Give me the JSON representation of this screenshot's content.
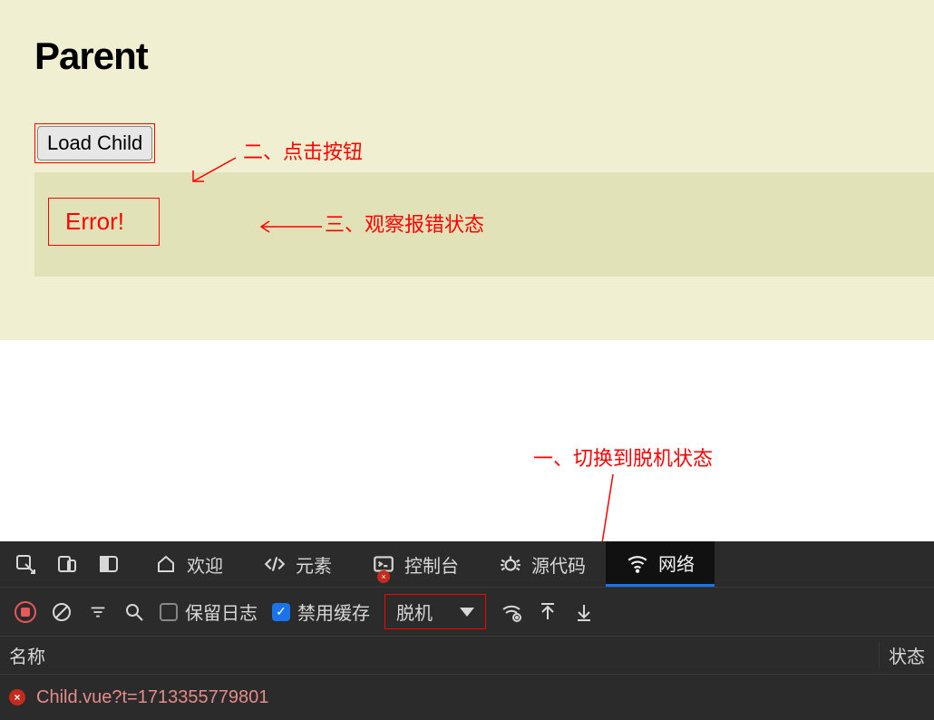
{
  "page": {
    "title": "Parent",
    "button_label": "Load Child",
    "error_text": "Error!"
  },
  "annotations": {
    "one": "一、切换到脱机状态",
    "two": "二、点击按钮",
    "three": "三、观察报错状态"
  },
  "devtools": {
    "tabs": {
      "welcome": "欢迎",
      "elements": "元素",
      "console": "控制台",
      "source": "源代码",
      "network": "网络"
    },
    "toolbar": {
      "preserve_log": "保留日志",
      "disable_cache": "禁用缓存",
      "throttle": "脱机"
    },
    "headers": {
      "name": "名称",
      "status": "状态"
    },
    "rows": [
      {
        "name": "Child.vue?t=1713355779801"
      }
    ]
  }
}
